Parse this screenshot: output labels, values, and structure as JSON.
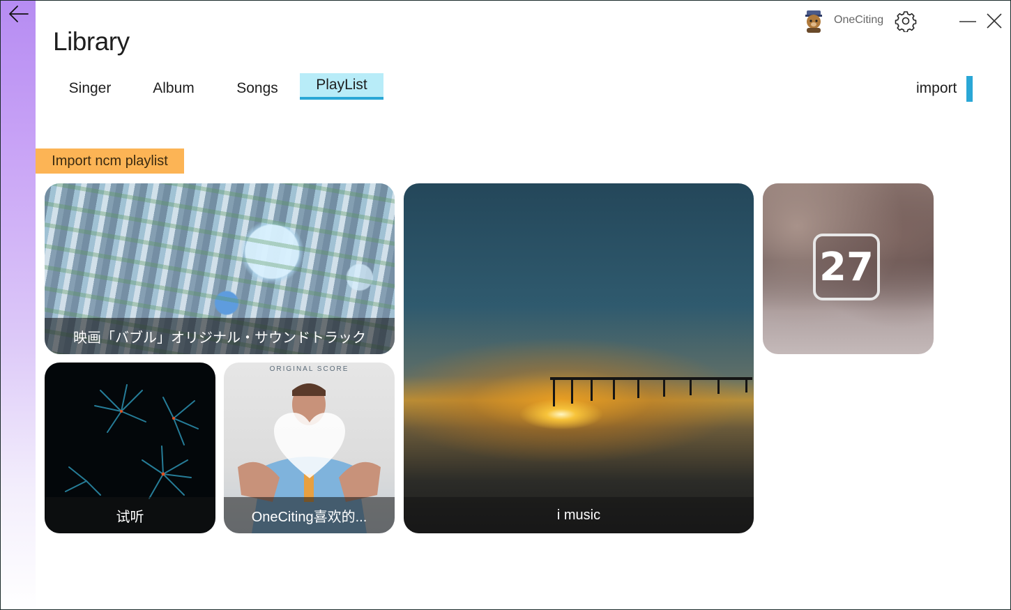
{
  "window": {
    "title": "Library"
  },
  "user": {
    "name": "OneCiting"
  },
  "tabs": [
    {
      "label": "Singer",
      "active": false
    },
    {
      "label": "Album",
      "active": false
    },
    {
      "label": "Songs",
      "active": false
    },
    {
      "label": "PlayList",
      "active": true
    }
  ],
  "actions": {
    "import_label": "import",
    "import_ncm_label": "Import ncm playlist"
  },
  "playlists": [
    {
      "title": "映画「バブル」オリジナル・サウンドトラック",
      "cover": "anime-bubble-art"
    },
    {
      "title": "i music",
      "cover": "sunset-pier-photo"
    },
    {
      "title": "",
      "cover": "calendar-27-blurred",
      "badge": "27"
    },
    {
      "title": "试听",
      "cover": "fireworks-photo"
    },
    {
      "title": "OneCiting喜欢的...",
      "cover": "movie-poster-heart",
      "poster_text": "ORIGINAL SCORE"
    }
  ],
  "colors": {
    "accent": "#2aa7d6",
    "active_tab_bg": "#b8ecf8",
    "import_ncm_bg": "#fcb455",
    "sidebar_gradient_top": "#b68cf2"
  },
  "icons": [
    "back-arrow-icon",
    "avatar-icon",
    "gear-icon",
    "minimize-icon",
    "close-icon",
    "heart-icon"
  ]
}
